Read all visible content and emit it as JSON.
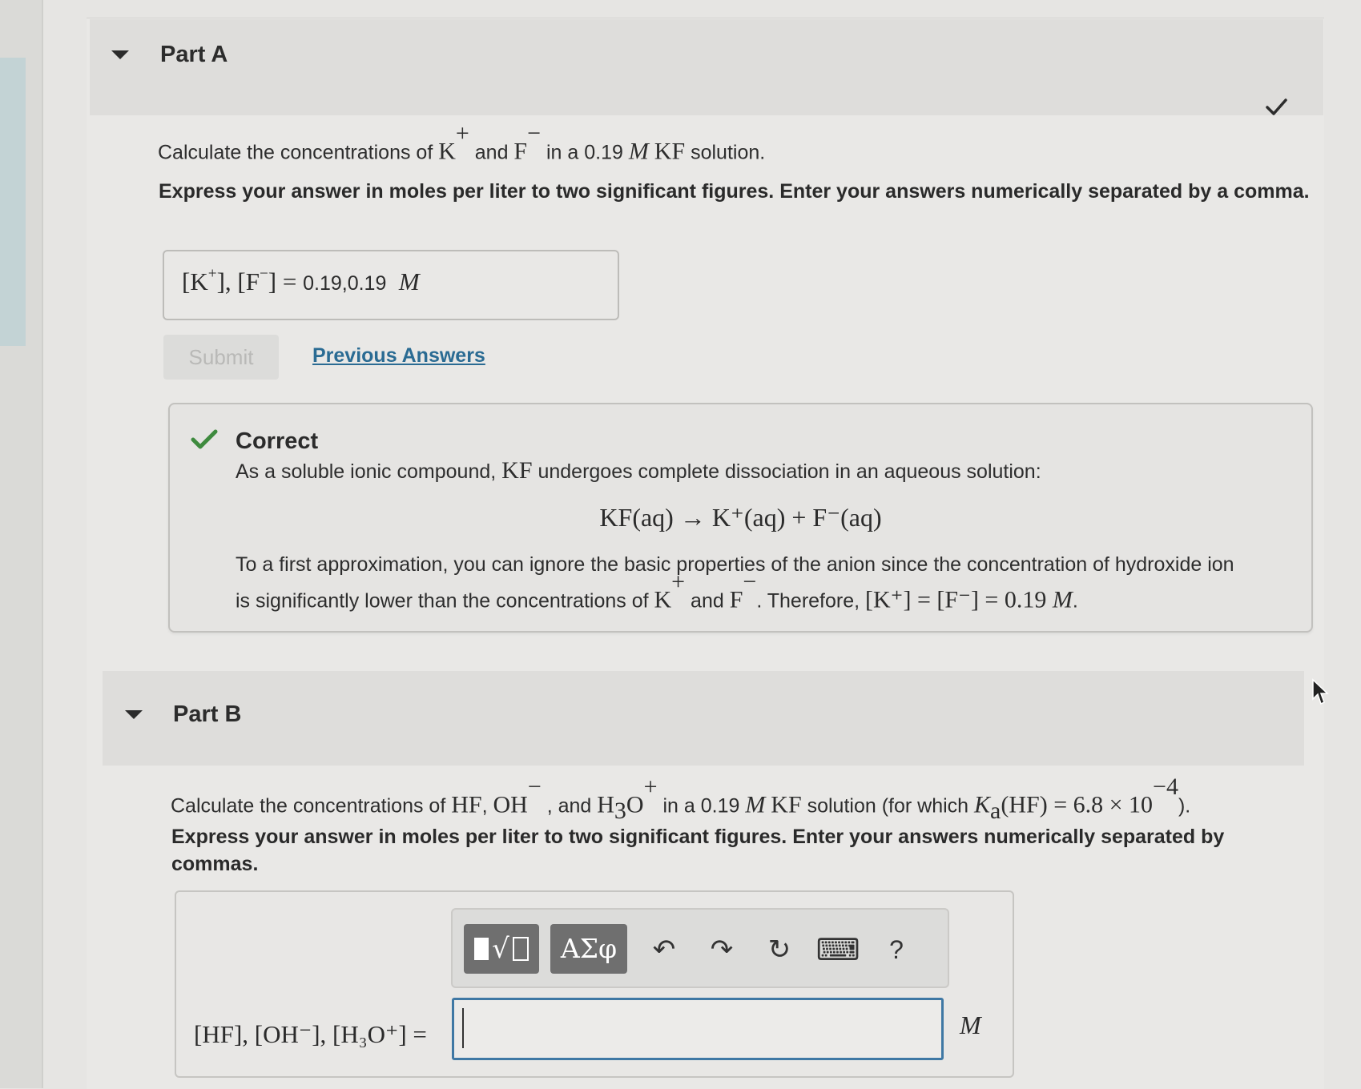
{
  "partA": {
    "title": "Part A",
    "question": {
      "prefix": "Calculate the concentrations of ",
      "ion1": "K",
      "ion1_charge": "+",
      "and": " and ",
      "ion2": "F",
      "ion2_charge": "−",
      "middle": " in a 0.19 ",
      "unit": "M",
      "compound": "KF",
      "suffix": " solution."
    },
    "instructions": "Express your answer in moles per liter to two significant figures. Enter your answers numerically separated by a comma.",
    "answer": {
      "label_k": "[K",
      "label_k_charge": "+",
      "label_mid": "], [F",
      "label_f_charge": "−",
      "label_end": "] = ",
      "value": "0.19,0.19",
      "unit": "M"
    },
    "submit_label": "Submit",
    "previous_answers_label": "Previous Answers",
    "feedback": {
      "title": "Correct",
      "line1_prefix": "As a soluble ionic compound, ",
      "line1_compound": "KF",
      "line1_suffix": " undergoes complete dissociation in an aqueous solution:",
      "equation": "KF(aq) → K⁺(aq) + F⁻(aq)",
      "line2": "To a first approximation, you can ignore the basic properties of the anion since the concentration of hydroxide ion",
      "line3_prefix": "is significantly lower than the concentrations of ",
      "line3_k": "K",
      "line3_and": " and ",
      "line3_f": "F",
      "line3_therefore": ". Therefore, ",
      "line3_result": "[K⁺] = [F⁻] = 0.19 "
    }
  },
  "partB": {
    "title": "Part B",
    "question": {
      "prefix": "Calculate the concentrations of ",
      "hf": "HF",
      "comma1": ", ",
      "oh": "OH",
      "oh_charge": "−",
      "and": " , and ",
      "h3o_a": "H",
      "h3o_sub": "3",
      "h3o_b": "O",
      "h3o_charge": "+",
      "middle": " in a 0.19 ",
      "unit": "M",
      "compound": "KF",
      "suffix": " solution (for which ",
      "ka": "K",
      "ka_sub": "a",
      "ka_rest": "(HF) = 6.8 × 10",
      "ka_exp": "−4",
      "end": ")."
    },
    "instructions": "Express your answer in moles per liter to two significant figures. Enter your answers numerically separated by commas.",
    "toolbar": {
      "templates_icon": "▮√▯",
      "symbols_label": "ΑΣφ",
      "undo_icon": "↶",
      "redo_icon": "↷",
      "reset_icon": "↻",
      "keyboard_icon": "⌨",
      "help_label": "?"
    },
    "answer": {
      "label": "[HF], [OH⁻], [H₃O⁺] = ",
      "value": "",
      "unit": "M"
    }
  }
}
